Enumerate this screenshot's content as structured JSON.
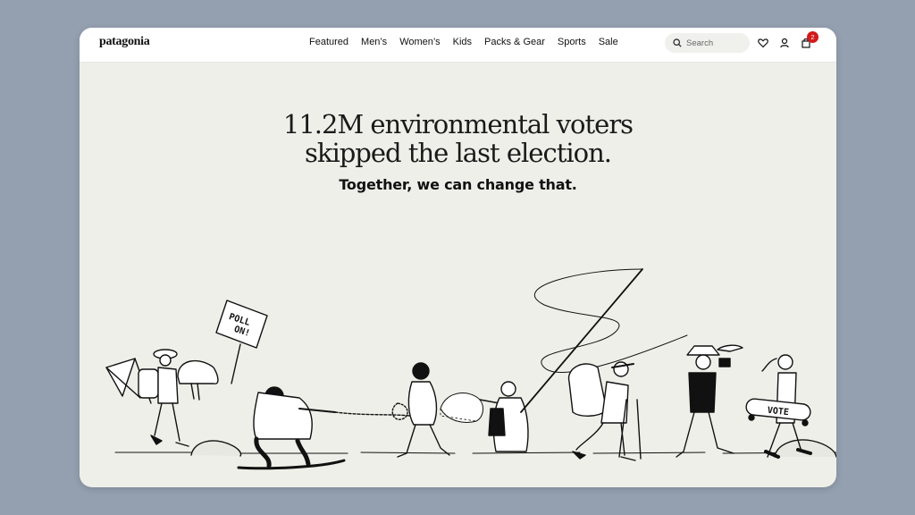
{
  "brand": {
    "logo": "patagonia"
  },
  "nav": {
    "links": [
      "Featured",
      "Men’s",
      "Women’s",
      "Kids",
      "Packs & Gear",
      "Sports",
      "Sale"
    ],
    "search_placeholder": "Search",
    "cart_count": "2",
    "icons": [
      "search-icon",
      "heart-icon",
      "account-icon",
      "bag-icon"
    ]
  },
  "hero": {
    "headline_line1": "11.2M environmental voters",
    "headline_line2": "skipped the last election.",
    "subheadline": "Together, we can change that."
  },
  "illustration": {
    "sign_line1": "POLL",
    "sign_line2": "ON!",
    "skateboard_text": "VOTE"
  },
  "colors": {
    "page_background": "#94a0b0",
    "hero_background": "#efefe9",
    "navbar_background": "#ffffff",
    "badge": "#d21a1a",
    "ink": "#111111"
  }
}
